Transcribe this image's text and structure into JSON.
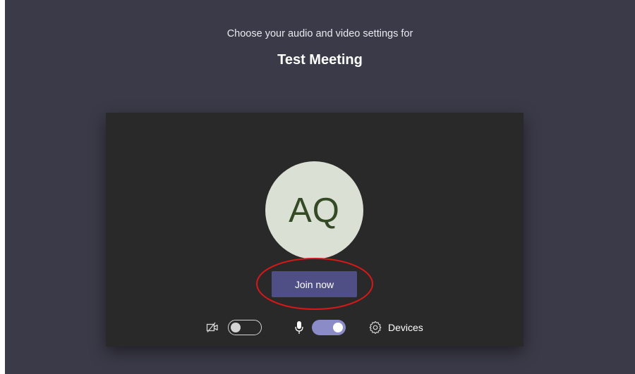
{
  "header": {
    "subtitle": "Choose your audio and video settings for",
    "meeting_title": "Test Meeting"
  },
  "preview": {
    "avatar_initials": "AQ",
    "join_button_label": "Join now"
  },
  "controls": {
    "camera_toggle_on": false,
    "mic_toggle_on": true,
    "devices_label": "Devices"
  },
  "colors": {
    "background": "#3b3a48",
    "preview_panel": "#292929",
    "avatar_bg": "#dbe0d4",
    "avatar_text": "#334a25",
    "join_button": "#4f4f86",
    "toggle_on": "#8b8cc7",
    "annotation": "#d81818"
  },
  "icons": {
    "camera": "camera-off-icon",
    "mic": "microphone-icon",
    "devices": "gear-icon"
  }
}
